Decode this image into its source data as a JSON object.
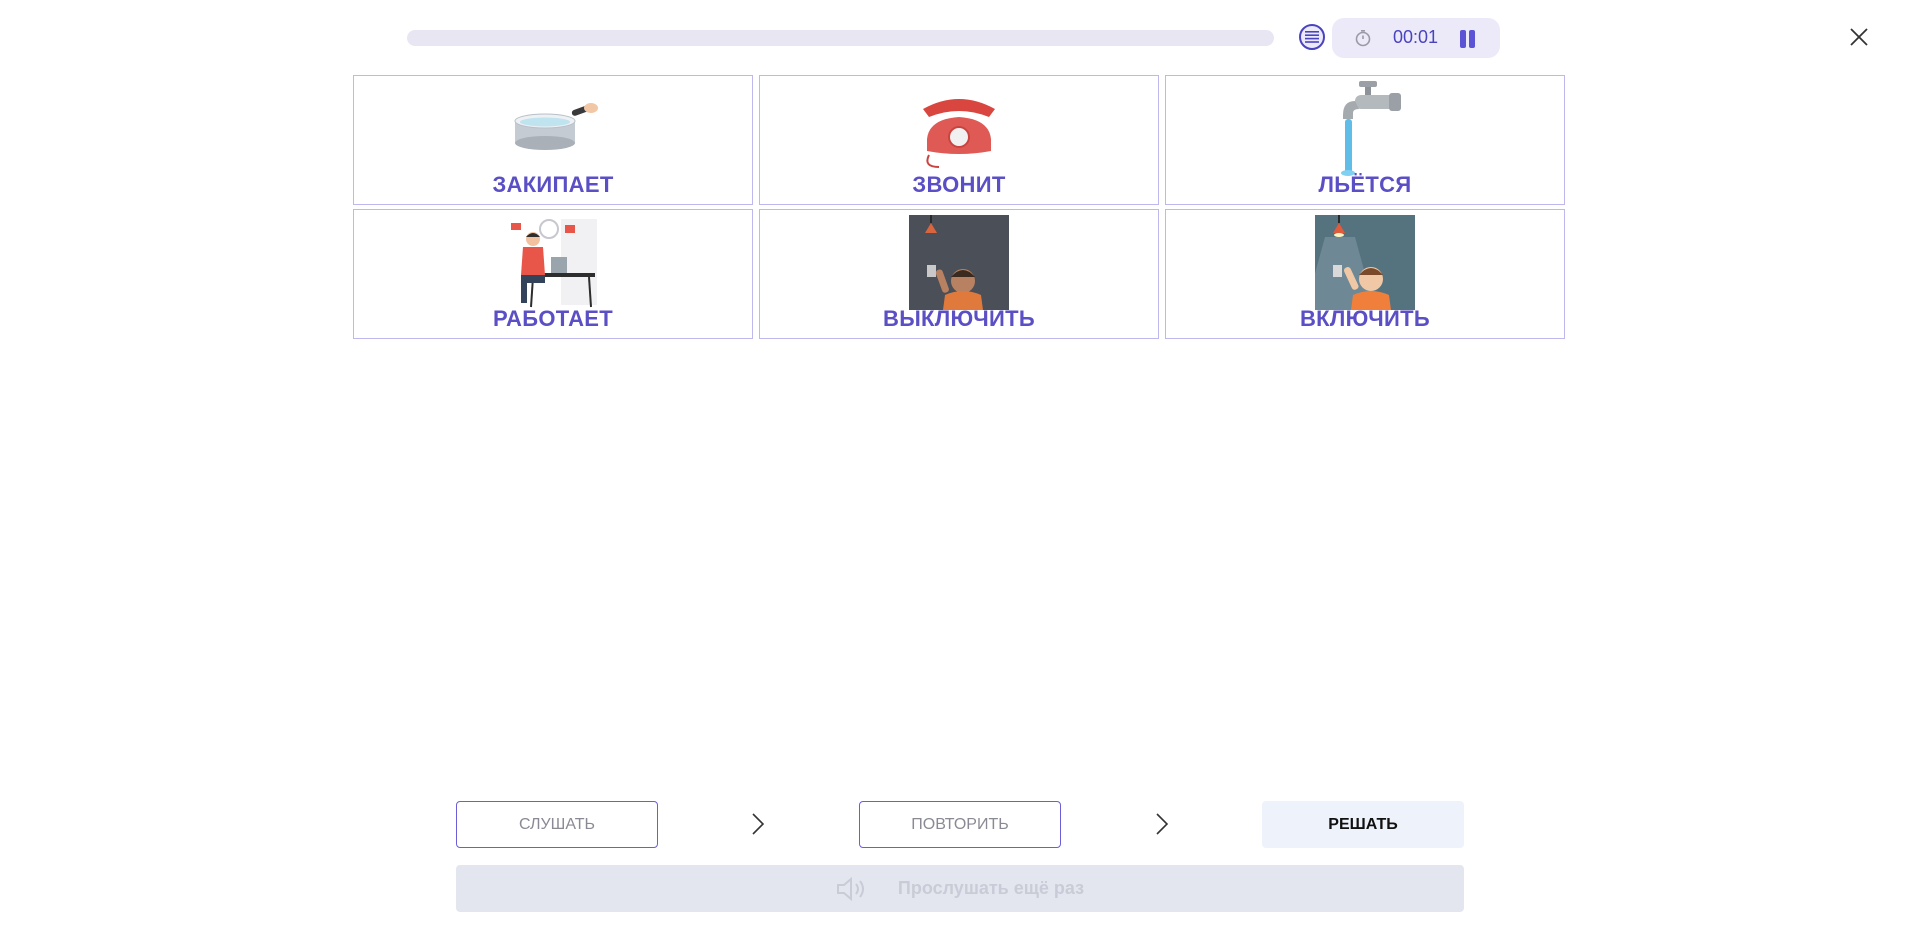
{
  "timer": {
    "time": "00:01"
  },
  "progress": {
    "fraction": 0.0
  },
  "cards": [
    {
      "label": "ЗАКИПАЕТ",
      "icon": "saucepan-boiling-icon"
    },
    {
      "label": "ЗВОНИТ",
      "icon": "telephone-icon"
    },
    {
      "label": "ЛЬЁТСЯ",
      "icon": "water-tap-icon"
    },
    {
      "label": "РАБОТАЕТ",
      "icon": "person-working-icon"
    },
    {
      "label": "ВЫКЛЮЧИТЬ",
      "icon": "boy-switch-off-icon"
    },
    {
      "label": "ВКЛЮЧИТЬ",
      "icon": "boy-switch-on-icon"
    }
  ],
  "controls": {
    "listen": "СЛУШАТЬ",
    "repeat": "ПОВТОРИТЬ",
    "solve": "РЕШАТЬ",
    "replay": "Прослушать ещё раз"
  },
  "colors": {
    "accent": "#5a4fc4",
    "card_border": "#bdb8ee",
    "pill_bg": "#eceaf8",
    "solve_bg": "#eef2fb",
    "replay_bg": "#e3e6ee"
  }
}
